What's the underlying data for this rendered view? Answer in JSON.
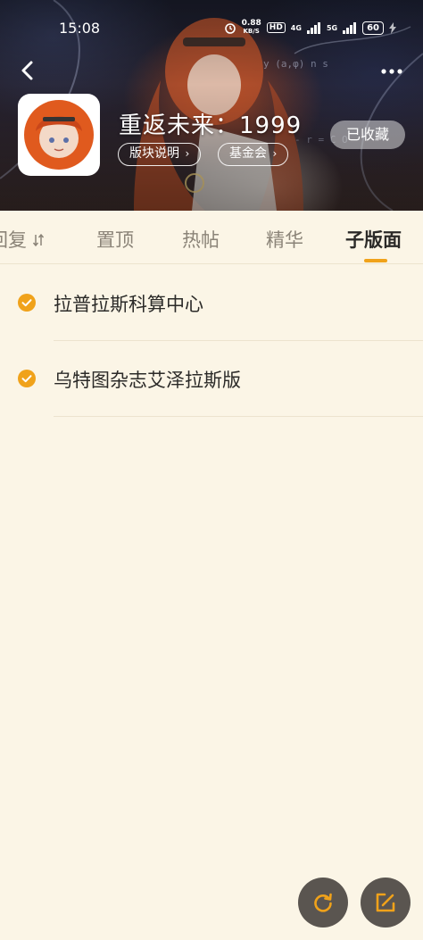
{
  "status_bar": {
    "time": "15:08",
    "net_speed_value": "0.88",
    "net_speed_unit": "KB/S",
    "hd_label": "HD",
    "signal_1_label": "4G",
    "signal_2_label": "5G",
    "battery": "60"
  },
  "forum": {
    "title": "重返未来：1999",
    "info_button": "版块说明",
    "fund_button": "基金会",
    "favorite_button": "已收藏"
  },
  "tabs": [
    {
      "label": "回复"
    },
    {
      "label": "置顶"
    },
    {
      "label": "热帖"
    },
    {
      "label": "精华"
    },
    {
      "label": "子版面"
    }
  ],
  "active_tab": "子版面",
  "subforums": [
    {
      "label": "拉普拉斯科算中心",
      "checked": true
    },
    {
      "label": "乌特图杂志艾泽拉斯版",
      "checked": true
    }
  ],
  "colors": {
    "background": "#fbf5e6",
    "accent": "#f0a21a",
    "fab": "#5a5550",
    "text_primary": "#2b2a28",
    "text_secondary": "#8b8478"
  },
  "icons": {
    "back": "back-arrow-icon",
    "more": "more-dots-icon",
    "check": "check-circle-icon",
    "refresh": "refresh-icon",
    "compose": "compose-icon",
    "sort": "sort-icon"
  }
}
